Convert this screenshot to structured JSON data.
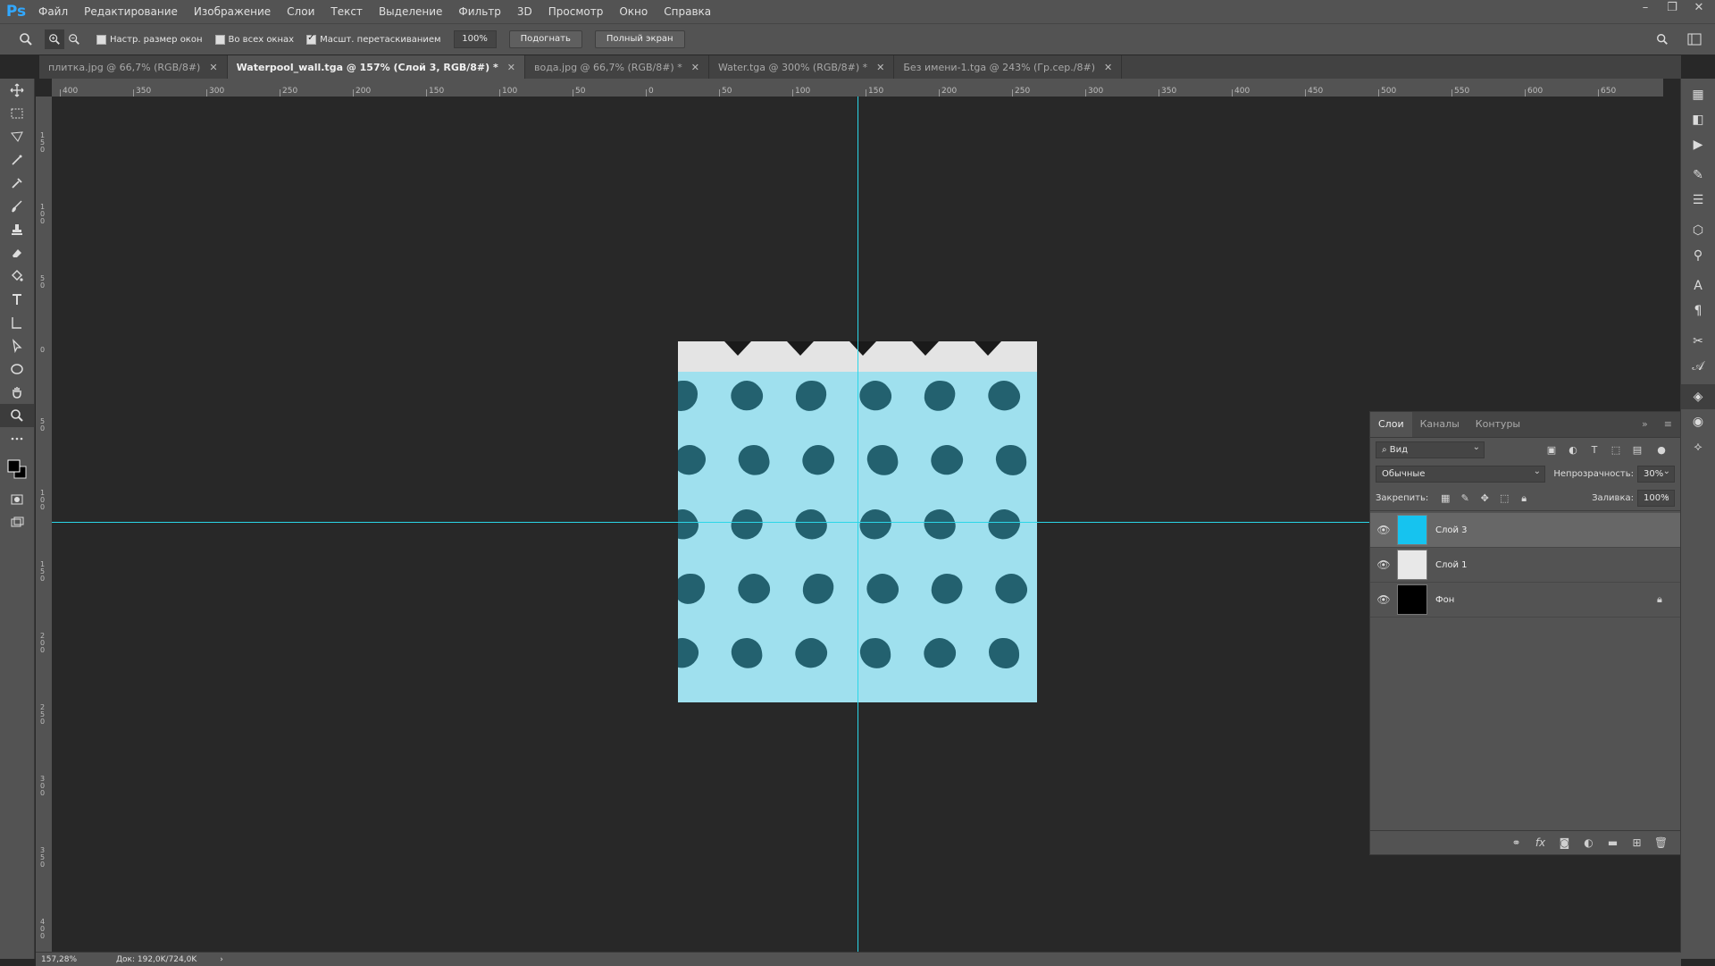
{
  "app": {
    "logo": "Ps"
  },
  "menu": [
    "Файл",
    "Редактирование",
    "Изображение",
    "Слои",
    "Текст",
    "Выделение",
    "Фильтр",
    "3D",
    "Просмотр",
    "Окно",
    "Справка"
  ],
  "window_controls": [
    "–",
    "❐",
    "✕"
  ],
  "options": {
    "resize_windows_label": "Настр. размер окон",
    "all_windows_label": "Во всех окнах",
    "scrubby_zoom_label": "Масшт. перетаскиванием",
    "zoom_value": "100%",
    "fit_button": "Подогнать",
    "fullscreen_button": "Полный экран"
  },
  "tabs": [
    {
      "label": "плитка.jpg @ 66,7% (RGB/8#)",
      "active": false
    },
    {
      "label": "Waterpool_wall.tga @ 157% (Слой 3, RGB/8#) *",
      "active": true
    },
    {
      "label": "вода.jpg @ 66,7% (RGB/8#) *",
      "active": false
    },
    {
      "label": "Water.tga @ 300% (RGB/8#) *",
      "active": false
    },
    {
      "label": "Без имени-1.tga @ 243% (Гр.сер./8#)",
      "active": false
    }
  ],
  "ruler_top": [
    "400",
    "350",
    "300",
    "250",
    "200",
    "150",
    "100",
    "50",
    "0",
    "50",
    "100",
    "150",
    "200",
    "250",
    "300",
    "350",
    "400",
    "450",
    "500",
    "550",
    "600",
    "650"
  ],
  "ruler_left": [
    "150",
    "100",
    "50",
    "0",
    "50",
    "100",
    "150",
    "200",
    "250",
    "300",
    "350",
    "400"
  ],
  "layers_panel": {
    "tabs": [
      "Слои",
      "Каналы",
      "Контуры"
    ],
    "filter_label": "Вид",
    "blend_mode": "Обычные",
    "opacity_label": "Непрозрачность:",
    "opacity_value": "30%",
    "lock_label": "Закрепить:",
    "fill_label": "Заливка:",
    "fill_value": "100%",
    "layers": [
      {
        "name": "Слой 3",
        "selected": true,
        "thumb_color": "#16c3ef",
        "locked": false
      },
      {
        "name": "Слой 1",
        "selected": false,
        "thumb_color": "#e8e8e8",
        "locked": false
      },
      {
        "name": "Фон",
        "selected": false,
        "thumb_color": "#000000",
        "locked": true
      }
    ],
    "footer_icons": [
      "link-icon",
      "fx-icon",
      "mask-icon",
      "adjustment-icon",
      "folder-icon",
      "new-layer-icon",
      "trash-icon"
    ]
  },
  "status": {
    "zoom": "157,28%",
    "doc_size": "Док: 192,0K/724,0K"
  },
  "colors": {
    "guide": "#2bd6e8",
    "water": "#9fe0ee",
    "tile": "#0d4a58",
    "accent": "#31a8ff"
  }
}
